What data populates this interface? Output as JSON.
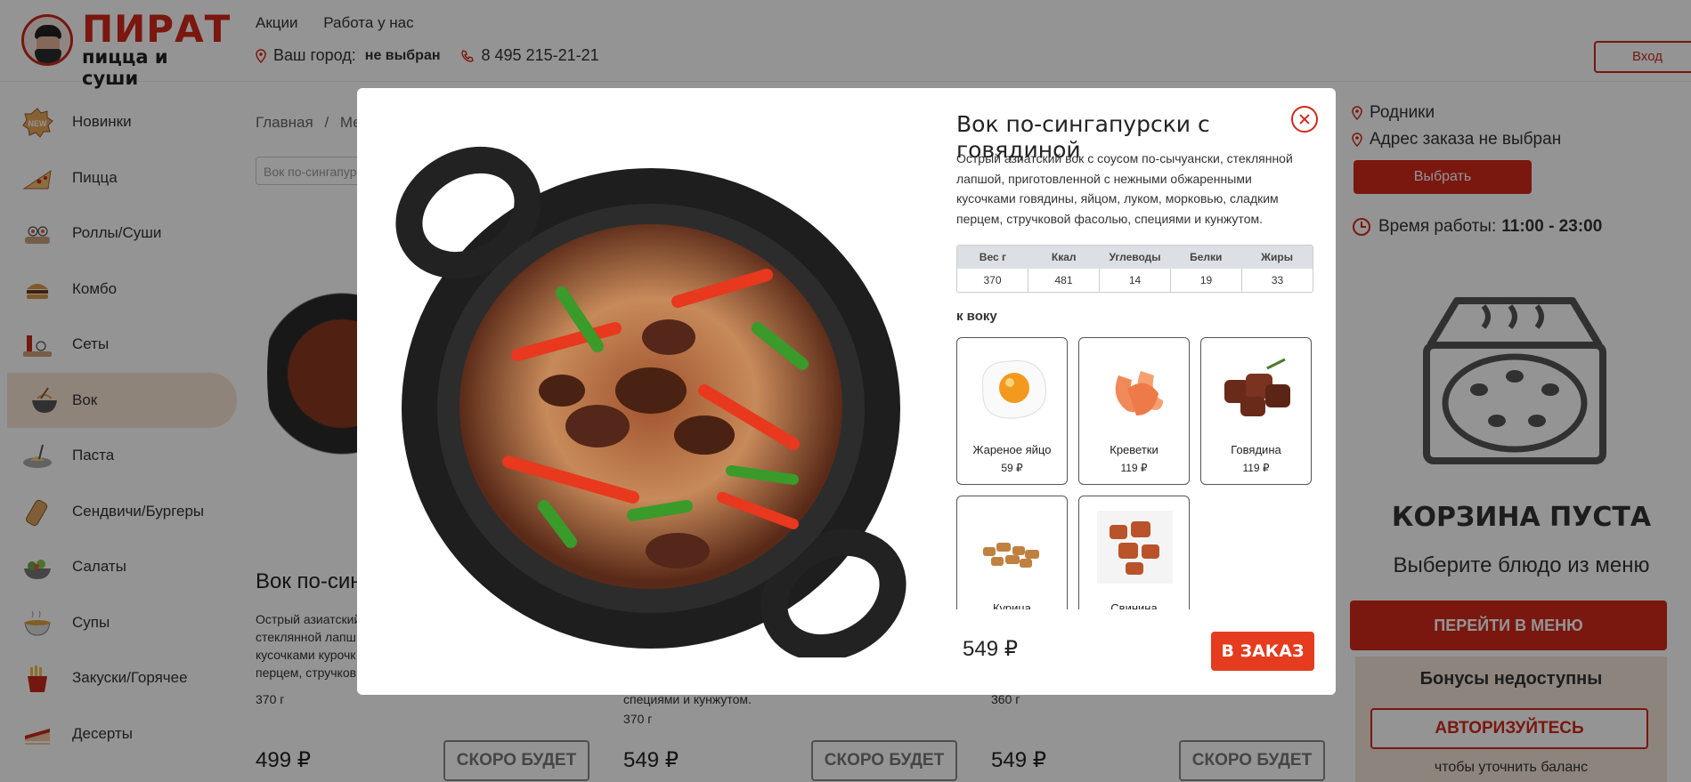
{
  "logo": {
    "title": "ПИРАТ",
    "subtitle": "пицца и суши"
  },
  "topnav": {
    "promo": "Акции",
    "jobs": "Работа у нас"
  },
  "city": {
    "label": "Ваш город:",
    "value": "не выбран"
  },
  "phone": "8 495 215-21-21",
  "login_label": "Вход",
  "sidebar": {
    "items": [
      {
        "label": "Новинки",
        "icon": "new-badge-icon"
      },
      {
        "label": "Пицца",
        "icon": "pizza-icon"
      },
      {
        "label": "Роллы/Суши",
        "icon": "rolls-icon"
      },
      {
        "label": "Комбо",
        "icon": "combo-icon"
      },
      {
        "label": "Сеты",
        "icon": "sets-icon"
      },
      {
        "label": "Вок",
        "icon": "wok-icon"
      },
      {
        "label": "Паста",
        "icon": "pasta-icon"
      },
      {
        "label": "Сендвичи/Бургеры",
        "icon": "burger-icon"
      },
      {
        "label": "Салаты",
        "icon": "salad-icon"
      },
      {
        "label": "Супы",
        "icon": "soup-icon"
      },
      {
        "label": "Закуски/Горячее",
        "icon": "snacks-icon"
      },
      {
        "label": "Десерты",
        "icon": "dessert-icon"
      }
    ],
    "active_index": 5
  },
  "breadcrumb": {
    "home": "Главная",
    "sep": "/",
    "current": "Мен"
  },
  "search": {
    "value": "Вок по-сингапур"
  },
  "cards": {
    "title_1": "Вок по-син",
    "desc_1": "Острый азиатский\nстеклянной лапш\nкусочками курочк\nперцем, стручков",
    "weight_1": "370 г",
    "desc_2": "специями и кунжутом.",
    "weight_2": "370 г",
    "weight_3": "360 г",
    "price_1": "499 ₽",
    "price_2": "549 ₽",
    "price_3": "549 ₽",
    "soon_label": "СКОРО БУДЕТ"
  },
  "right_panel": {
    "location": "Родники",
    "address": "Адрес заказа не выбран",
    "choose_label": "Выбрать",
    "hours_label": "Время работы:",
    "hours_value": "11:00 - 23:00",
    "empty_title": "КОРЗИНА ПУСТА",
    "empty_sub": "Выберите блюдо из меню",
    "menu_label": "ПЕРЕЙТИ В МЕНЮ",
    "bonus_title": "Бонусы недоступны",
    "auth_label": "АВТОРИЗУЙТЕСЬ",
    "bonus_note": "чтобы уточнить баланс"
  },
  "modal": {
    "title": "Вок по-сингапурски с говядиной",
    "description": "Острый азиатский вок с соусом по-сычуански, стеклянной лапшой, приготовленной с нежными обжаренными кусочками говядины, яйцом, луком, морковью, сладким перцем, стручковой фасолью, специями и кунжутом.",
    "nutrition": {
      "headers": [
        "Вес г",
        "Ккал",
        "Углеводы",
        "Белки",
        "Жиры"
      ],
      "values": [
        "370",
        "481",
        "14",
        "19",
        "33"
      ]
    },
    "addons_label": "к воку",
    "addons": [
      {
        "name": "Жареное яйцо",
        "price": "59 ₽"
      },
      {
        "name": "Креветки",
        "price": "119 ₽"
      },
      {
        "name": "Говядина",
        "price": "119 ₽"
      },
      {
        "name": "Курица",
        "price": ""
      },
      {
        "name": "Свинина",
        "price": ""
      }
    ],
    "price": "549 ₽",
    "order_label": "В ЗАКАЗ"
  },
  "colors": {
    "brand": "#d3291b",
    "order": "#e53b1e",
    "active_bg": "#f7e3d3"
  }
}
